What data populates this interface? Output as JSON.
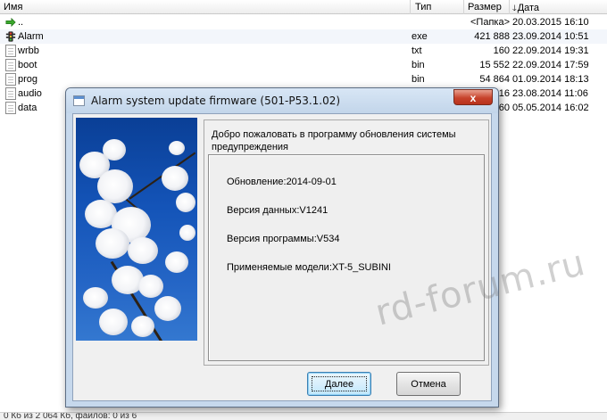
{
  "file_list": {
    "columns": {
      "name": "Имя",
      "type": "Тип",
      "size": "Размер",
      "date": "Дата"
    },
    "rows": [
      {
        "name": "..",
        "type": "",
        "size": "<Папка>",
        "date": "20.03.2015 16:10",
        "icon": "up-arrow-icon"
      },
      {
        "name": "Alarm",
        "type": "exe",
        "size": "421 888",
        "date": "23.09.2014 10:51",
        "icon": "traffic-light-icon"
      },
      {
        "name": "wrbb",
        "type": "txt",
        "size": "160",
        "date": "22.09.2014 19:31",
        "icon": "document-icon"
      },
      {
        "name": "boot",
        "type": "bin",
        "size": "15 552",
        "date": "22.09.2014 17:59",
        "icon": "document-icon"
      },
      {
        "name": "prog",
        "type": "bin",
        "size": "54 864",
        "date": "01.09.2014 18:13",
        "icon": "document-icon"
      },
      {
        "name": "audio",
        "type": "",
        "size": "16",
        "date": "23.08.2014 11:06",
        "icon": "document-icon"
      },
      {
        "name": "data",
        "type": "",
        "size": "60",
        "date": "05.05.2014 16:02",
        "icon": "document-icon"
      }
    ]
  },
  "status_bar": {
    "text": "0 Кб из 2 064 Кб, файлов: 0 из 6"
  },
  "dialog": {
    "title": "Alarm system update firmware (501-P53.1.02)",
    "close_label": "x",
    "welcome_text": "Добро пожаловать в программу обновления системы предупреждения",
    "info": {
      "update": "Обновление:2014-09-01",
      "data_version": "Версия данных:V1241",
      "program_version": "Версия программы:V534",
      "models": "Применяемые модели:XT-5_SUBINI"
    },
    "next_label": "Далее",
    "cancel_label": "Отмена"
  },
  "watermark": "rd-forum.ru"
}
